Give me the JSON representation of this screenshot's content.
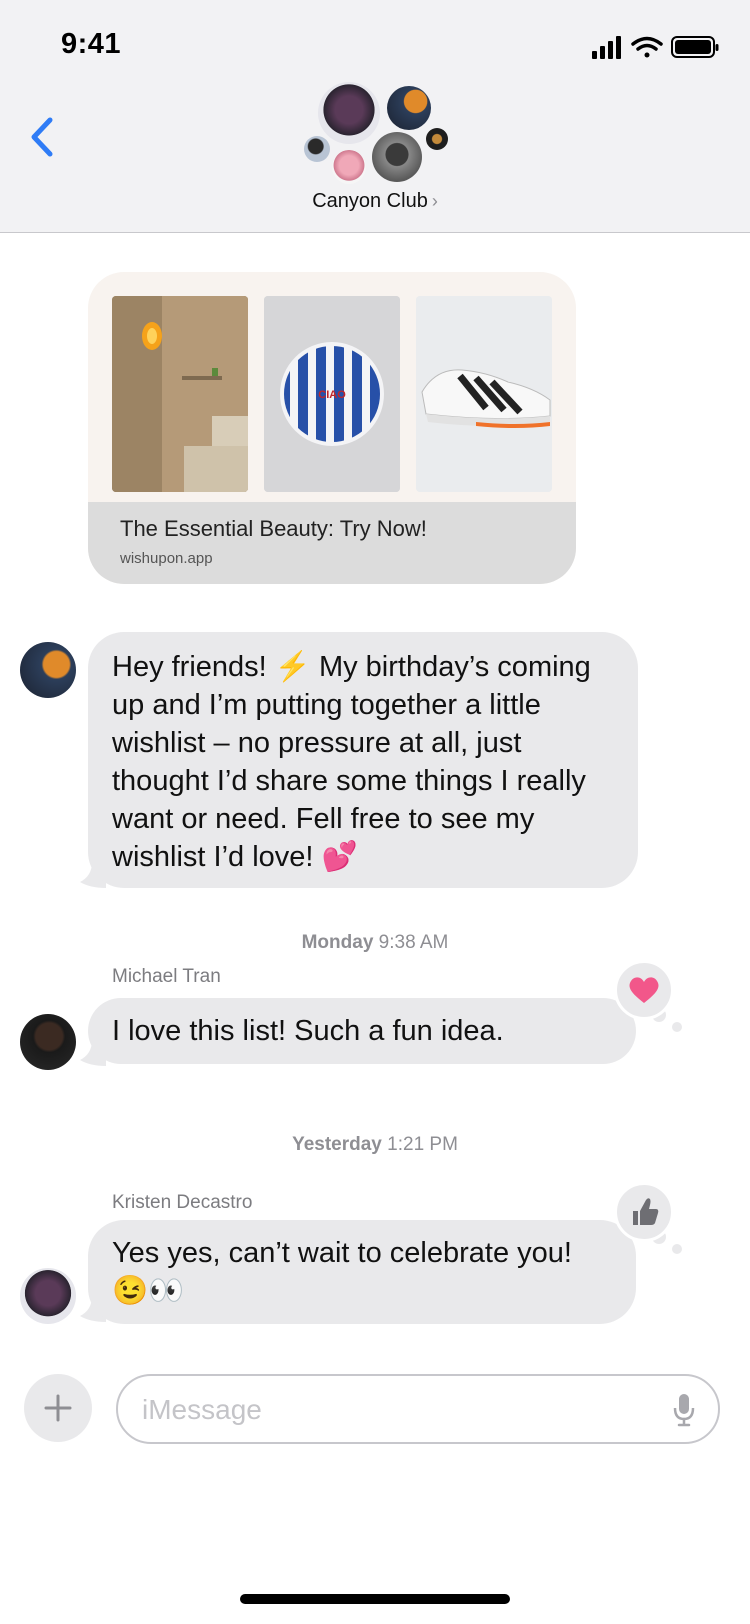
{
  "status_bar": {
    "time": "9:41"
  },
  "conversation": {
    "group_name": "Canyon Club"
  },
  "link_preview": {
    "title": "The Essential Beauty: Try Now!",
    "domain": "wishupon.app",
    "plate_text": "CIAO"
  },
  "messages": [
    {
      "text": "Hey friends! ⚡ My birthday’s coming up and I’m putting together a little wishlist – no pressure at all, just thought I’d share some things I really want or need. Fell free to see my wishlist I’d love! 💕"
    },
    {
      "timestamp_day": "Monday",
      "timestamp_time": "9:38 AM",
      "sender": "Michael Tran",
      "text": "I love this list! Such a fun idea.",
      "tapback": "heart-icon"
    },
    {
      "timestamp_day": "Yesterday",
      "timestamp_time": "1:21 PM",
      "sender": "Kristen Decastro",
      "text": "Yes yes, can’t wait to celebrate you! 😉👀",
      "tapback": "thumbs-up-icon"
    }
  ],
  "composer": {
    "placeholder": "iMessage"
  },
  "colors": {
    "accent": "#2f7cf6",
    "bubble": "#e9e9eb",
    "heart": "#f2578a"
  }
}
